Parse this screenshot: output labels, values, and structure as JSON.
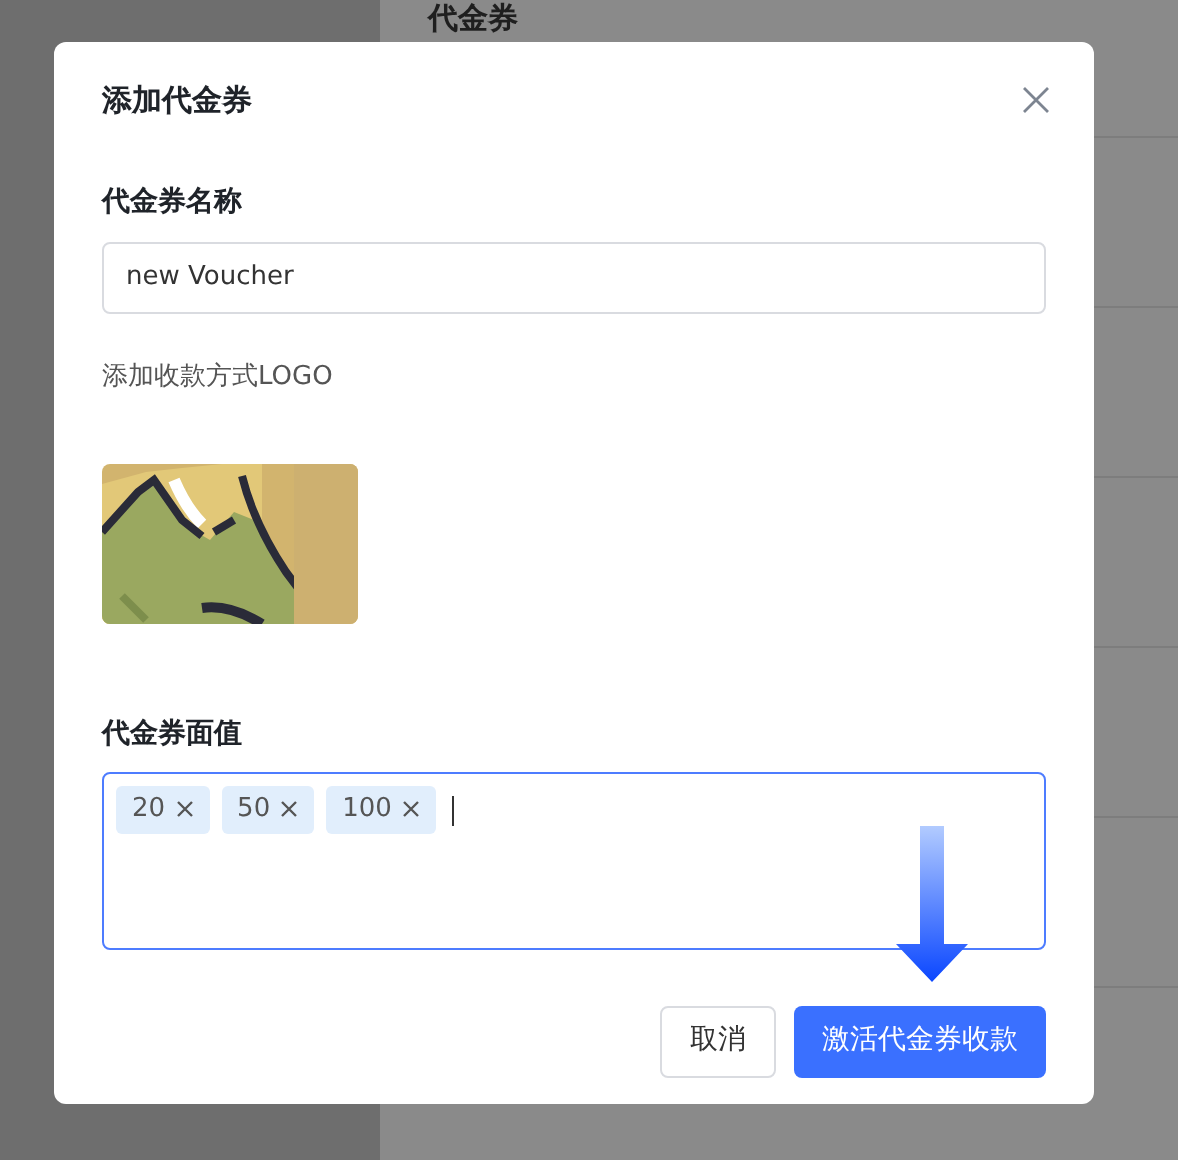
{
  "background_page": {
    "heading": "代金券"
  },
  "dialog": {
    "title": "添加代金券",
    "name_field": {
      "label": "代金券名称",
      "value": "new Voucher"
    },
    "logo": {
      "label": "添加收款方式LOGO"
    },
    "amount_field": {
      "label": "代金券面值",
      "focused": true,
      "tags": [
        {
          "label": "20"
        },
        {
          "label": "50"
        },
        {
          "label": "100"
        }
      ]
    },
    "buttons": [
      {
        "label": "取消",
        "kind": "secondary"
      },
      {
        "label": "激活代金券收款",
        "kind": "primary"
      }
    ]
  }
}
